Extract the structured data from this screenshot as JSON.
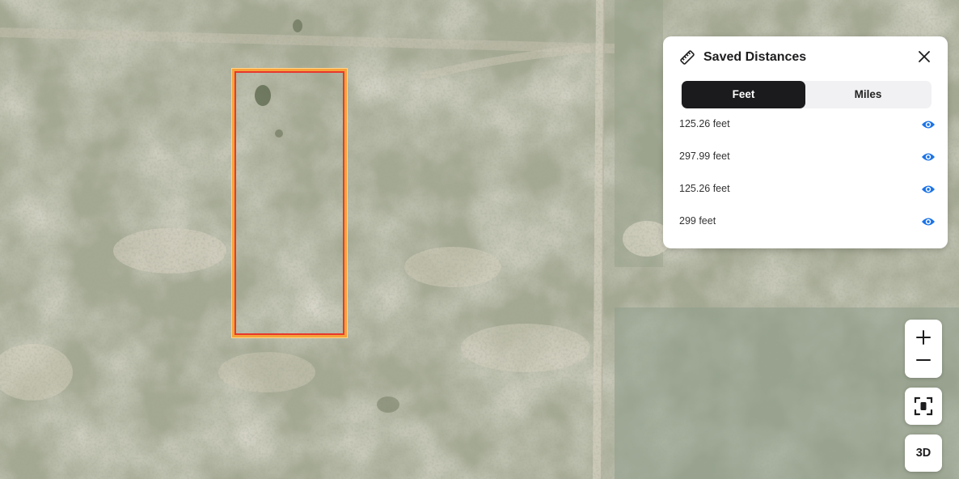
{
  "panel": {
    "title": "Saved Distances",
    "icons": {
      "header": "ruler-icon",
      "close": "close-icon",
      "row": "eye-icon"
    },
    "units": {
      "feet_label": "Feet",
      "miles_label": "Miles",
      "selected": "Feet"
    },
    "distances": [
      {
        "value": "125.26 feet"
      },
      {
        "value": "297.99 feet"
      },
      {
        "value": "125.26 feet"
      },
      {
        "value": "299 feet"
      }
    ]
  },
  "controls": {
    "zoom_in_icon": "plus-icon",
    "zoom_out_icon": "minus-icon",
    "recenter_icon": "focus-icon",
    "three_d_label": "3D"
  },
  "colors": {
    "accent_dark": "#1b1b1d",
    "eye_blue": "#1a73e8",
    "parcel_outline": "#e8372c",
    "parcel_glow": "#f5a33a"
  }
}
